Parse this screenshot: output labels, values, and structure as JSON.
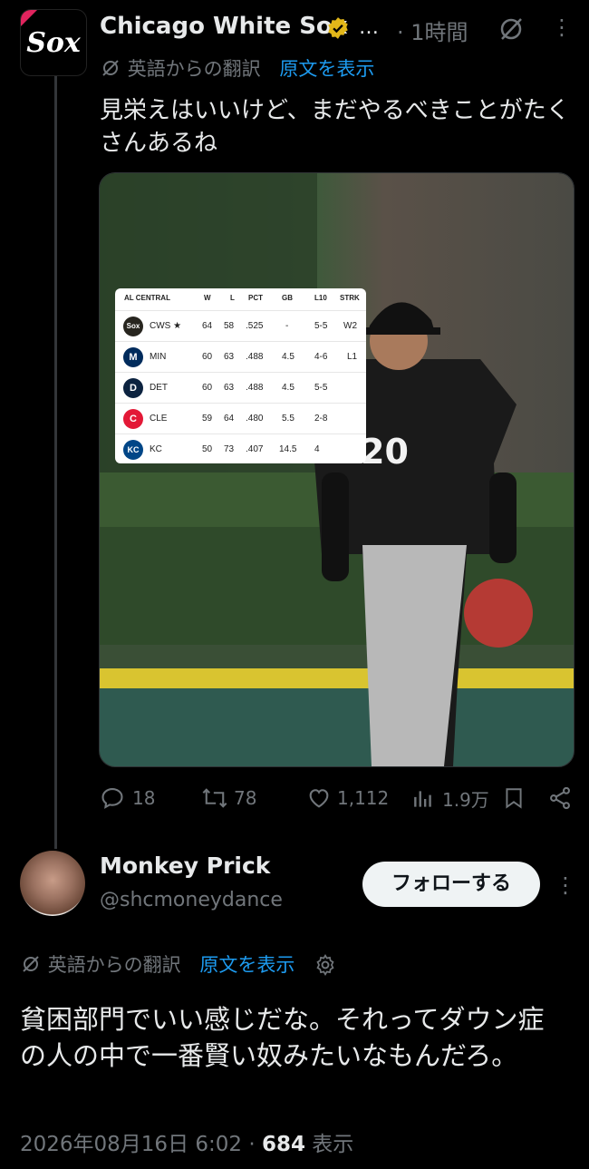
{
  "tweet1": {
    "author": "Chicago White Sox",
    "ellipsis": "…",
    "time": "· 1時間",
    "translation_label": "英語からの翻訳",
    "show_original": "原文を表示",
    "text": "見栄えはいいけど、まだやるべきことがたくさんあるね",
    "standings": {
      "division": "AL CENTRAL",
      "columns": [
        "W",
        "L",
        "PCT",
        "GB",
        "L10",
        "STRK"
      ],
      "rows": [
        {
          "team": "CWS ★",
          "logo": "Sox",
          "color": "#27251f",
          "w": "64",
          "l": "58",
          "pct": ".525",
          "gb": "-",
          "l10": "5-5",
          "strk": "W2"
        },
        {
          "team": "MIN",
          "logo": "M",
          "color": "#002b5c",
          "w": "60",
          "l": "63",
          "pct": ".488",
          "gb": "4.5",
          "l10": "4-6",
          "strk": "L1"
        },
        {
          "team": "DET",
          "logo": "D",
          "color": "#0c2340",
          "w": "60",
          "l": "63",
          "pct": ".488",
          "gb": "4.5",
          "l10": "5-5",
          "strk": ""
        },
        {
          "team": "CLE",
          "logo": "C",
          "color": "#e31937",
          "w": "59",
          "l": "64",
          "pct": ".480",
          "gb": "5.5",
          "l10": "2-8",
          "strk": ""
        },
        {
          "team": "KC",
          "logo": "KC",
          "color": "#004687",
          "w": "50",
          "l": "73",
          "pct": ".407",
          "gb": "14.5",
          "l10": "4",
          "strk": ""
        }
      ]
    },
    "player_number": "20",
    "actions": {
      "replies": "18",
      "reposts": "78",
      "likes": "1,112",
      "views": "1.9万"
    }
  },
  "tweet2": {
    "author": "Monkey Prick",
    "handle": "@shcmoneydance",
    "follow_label": "フォローする",
    "translation_label": "英語からの翻訳",
    "show_original": "原文を表示",
    "text": "貧困部門でいい感じだな。それってダウン症の人の中で一番賢い奴みたいなもんだろ。",
    "datetime": "2026年08月16日 6:02",
    "views_count": "684",
    "views_label": "表示"
  },
  "colors": {
    "accent": "#1d9bf0",
    "muted": "#71767b",
    "text": "#e7e9ea",
    "verified": "#e2b719"
  }
}
